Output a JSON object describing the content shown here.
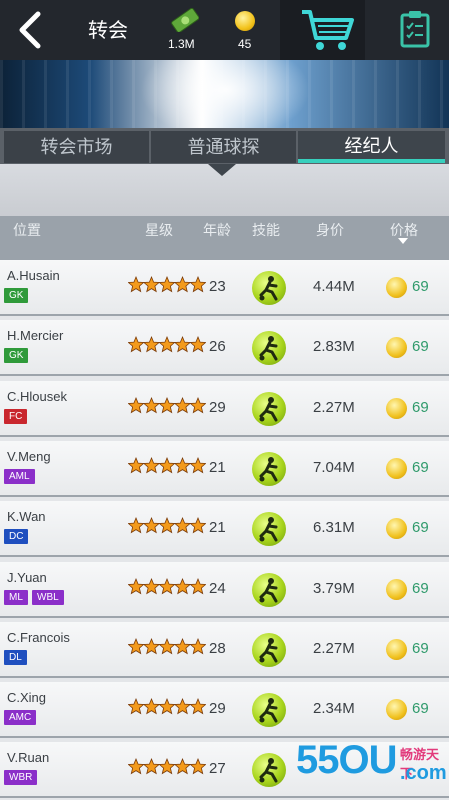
{
  "header": {
    "title": "转会",
    "cash_value": "1.3M",
    "coin_value": "45"
  },
  "tabs": [
    {
      "label": "转会市场",
      "active": false
    },
    {
      "label": "普通球探",
      "active": false
    },
    {
      "label": "经纪人",
      "active": true
    }
  ],
  "columns": {
    "position": "位置",
    "stars": "星级",
    "age": "年龄",
    "skill": "技能",
    "value": "身价",
    "price": "价格"
  },
  "players": [
    {
      "name": "A.Husain",
      "positions": [
        "GK"
      ],
      "age": "23",
      "value": "4.44M",
      "price": "69",
      "stars": 5
    },
    {
      "name": "H.Mercier",
      "positions": [
        "GK"
      ],
      "age": "26",
      "value": "2.83M",
      "price": "69",
      "stars": 5
    },
    {
      "name": "C.Hlousek",
      "positions": [
        "FC"
      ],
      "age": "29",
      "value": "2.27M",
      "price": "69",
      "stars": 5
    },
    {
      "name": "V.Meng",
      "positions": [
        "AML"
      ],
      "age": "21",
      "value": "7.04M",
      "price": "69",
      "stars": 5
    },
    {
      "name": "K.Wan",
      "positions": [
        "DC"
      ],
      "age": "21",
      "value": "6.31M",
      "price": "69",
      "stars": 5
    },
    {
      "name": "J.Yuan",
      "positions": [
        "ML",
        "WBL"
      ],
      "age": "24",
      "value": "3.79M",
      "price": "69",
      "stars": 5
    },
    {
      "name": "C.Francois",
      "positions": [
        "DL"
      ],
      "age": "28",
      "value": "2.27M",
      "price": "69",
      "stars": 5
    },
    {
      "name": "C.Xing",
      "positions": [
        "AMC"
      ],
      "age": "29",
      "value": "2.34M",
      "price": "69",
      "stars": 5
    },
    {
      "name": "V.Ruan",
      "positions": [
        "WBR"
      ],
      "age": "27",
      "value": "",
      "price": "",
      "stars": 5
    }
  ],
  "position_colors": {
    "GK": "#2f9a3a",
    "FC": "#c9272e",
    "AML": "#8b2fc9",
    "ML": "#8b2fc9",
    "WBL": "#8b2fc9",
    "AMC": "#8b2fc9",
    "WBR": "#8b2fc9",
    "DC": "#1f4fbf",
    "DL": "#1f4fbf"
  },
  "accent_color": "#37d0bd",
  "watermark": {
    "number": "55OU",
    "small_text": "畅游天下",
    "com_text": ".com"
  }
}
